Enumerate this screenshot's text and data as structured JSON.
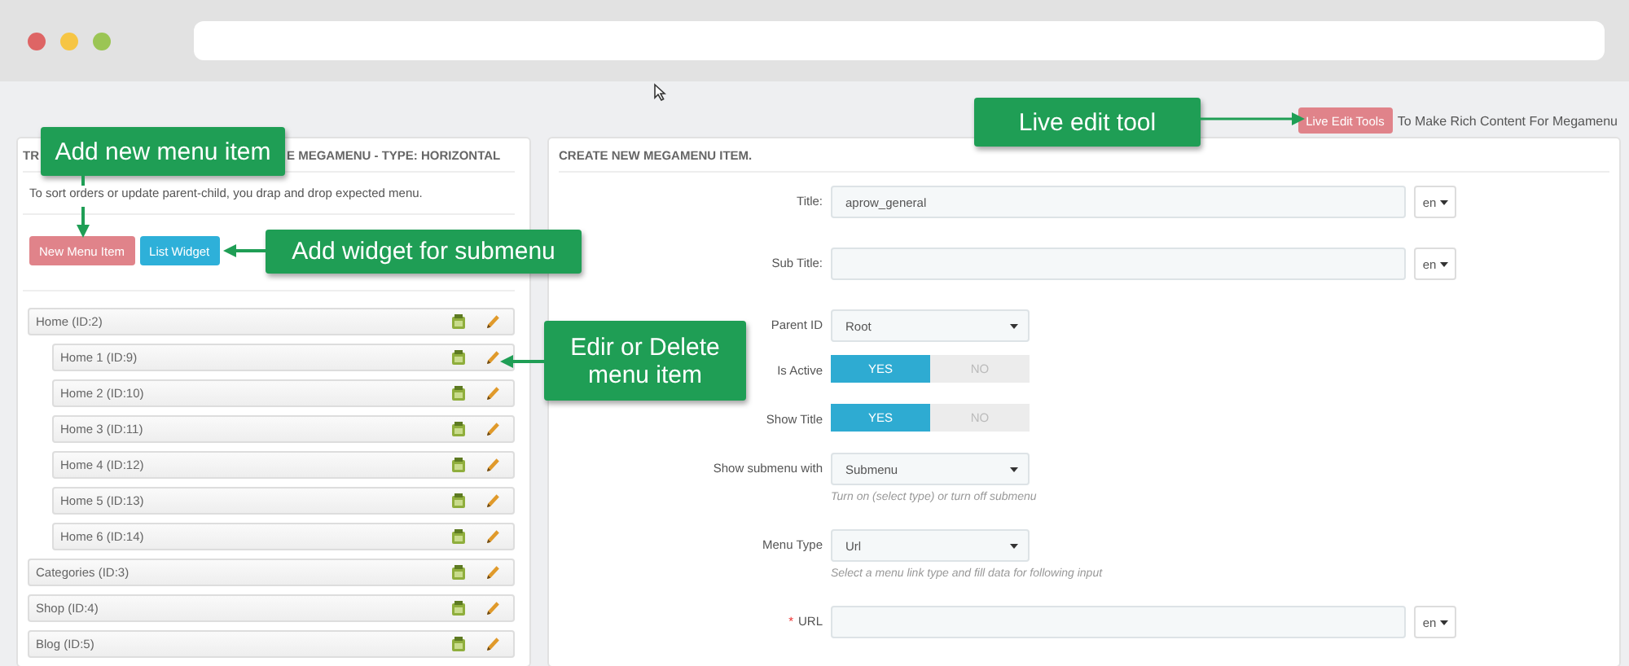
{
  "toolbar": {
    "button": "Live Edit Tools",
    "note": "To Make Rich Content For Megamenu"
  },
  "tree_panel": {
    "title_start": "TR",
    "title_end": "E MEGAMENU - TYPE: HORIZONTAL",
    "description": "To sort orders or update parent-child, you drap and drop expected menu.",
    "buttons": [
      {
        "label": "New Menu Item",
        "kind": "danger"
      },
      {
        "label": "List Widget",
        "kind": "info"
      }
    ],
    "items": [
      {
        "label": "Home (ID:2)",
        "children": [
          {
            "label": "Home 1 (ID:9)"
          },
          {
            "label": "Home 2 (ID:10)"
          },
          {
            "label": "Home 3 (ID:11)"
          },
          {
            "label": "Home 4 (ID:12)"
          },
          {
            "label": "Home 5 (ID:13)"
          },
          {
            "label": "Home 6 (ID:14)"
          }
        ]
      },
      {
        "label": "Categories (ID:3)"
      },
      {
        "label": "Shop (ID:4)"
      },
      {
        "label": "Blog (ID:5)"
      }
    ]
  },
  "form_panel": {
    "title": "CREATE NEW MEGAMENU ITEM.",
    "fields": [
      {
        "kind": "text",
        "label": "Title:",
        "value": "aprow_general",
        "lang": "en"
      },
      {
        "kind": "text",
        "label": "Sub Title:",
        "lang": "en"
      },
      {
        "kind": "select",
        "label": "Parent ID",
        "value": "Root"
      },
      {
        "kind": "toggle",
        "label": "Is Active",
        "options": [
          {
            "label": "YES",
            "selected": true
          },
          {
            "label": "NO",
            "selected": false
          }
        ]
      },
      {
        "kind": "toggle",
        "label": "Show Title",
        "options": [
          {
            "label": "YES",
            "selected": true
          },
          {
            "label": "NO",
            "selected": false
          }
        ]
      },
      {
        "kind": "select",
        "label": "Show submenu with",
        "value": "Submenu",
        "hint": "Turn on (select type) or turn off submenu"
      },
      {
        "kind": "select",
        "label": "Menu Type",
        "value": "Url",
        "hint": "Select a menu link type and fill data for following input"
      },
      {
        "kind": "text",
        "label": "URL",
        "required_mark": "*",
        "lang": "en"
      }
    ]
  },
  "callouts": [
    {
      "text": "Add new menu item"
    },
    {
      "text": "Add widget for submenu"
    },
    {
      "text": "Edir or Delete menu item"
    },
    {
      "text": "Live edit tool"
    }
  ]
}
